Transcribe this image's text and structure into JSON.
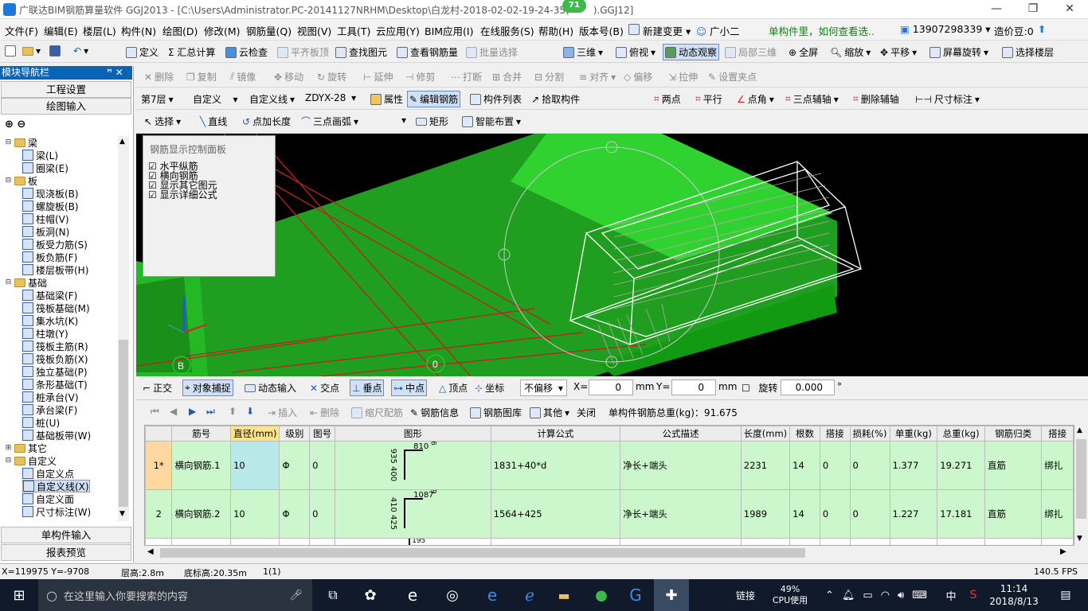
{
  "app": {
    "title": "广联达BIM钢筋算量软件 GGJ2013 - [C:\\Users\\Administrator.PC-20141127NRHM\\Desktop\\白龙村-2018-02-02-19-24-35(",
    "title_tail": ").GGJ12]",
    "badge": "71"
  },
  "menus": [
    "文件(F)",
    "编辑(E)",
    "楼层(L)",
    "构件(N)",
    "绘图(D)",
    "修改(M)",
    "钢筋量(Q)",
    "视图(V)",
    "工具(T)",
    "云应用(Y)",
    "BIM应用(I)",
    "在线服务(S)",
    "帮助(H)",
    "版本号(B)",
    "新建变更",
    "广小二",
    "单构件里，如何查看选..",
    "13907298339",
    "造价豆:0"
  ],
  "toolbar1": [
    "定义",
    "Σ 汇总计算",
    "云检查",
    "平齐板顶",
    "查找图元",
    "查看钢筋量",
    "批量选择",
    "三维",
    "俯视",
    "动态观察",
    "局部三维",
    "全屏",
    "缩放",
    "平移",
    "屏幕旋转",
    "选择楼层"
  ],
  "toolbar2": [
    "删除",
    "复制",
    "镜像",
    "移动",
    "旋转",
    "延伸",
    "修剪",
    "打断",
    "合并",
    "分割",
    "对齐",
    "偏移",
    "拉伸",
    "设置夹点"
  ],
  "toolbar3": {
    "floor": "第7层",
    "cat": "自定义",
    "sub": "自定义线",
    "code": "ZDYX-28",
    "items": [
      "属性",
      "编辑钢筋",
      "构件列表",
      "拾取构件"
    ],
    "axis": [
      "两点",
      "平行",
      "点角",
      "三点辅轴",
      "删除辅轴",
      "尺寸标注"
    ]
  },
  "toolbar4": [
    "选择",
    "直线",
    "点加长度",
    "三点画弧",
    "矩形",
    "智能布置"
  ],
  "nav": {
    "header": "模块导航栏",
    "pin": "ꟸ ✕",
    "btn1": "工程设置",
    "btn2": "绘图输入",
    "btn3": "单构件输入",
    "btn4": "报表预览"
  },
  "tree": [
    {
      "t": "梁",
      "lvl": 0,
      "f": true,
      "e": "⊟"
    },
    {
      "t": "梁(L)",
      "lvl": 1
    },
    {
      "t": "圈梁(E)",
      "lvl": 1
    },
    {
      "t": "板",
      "lvl": 0,
      "f": true,
      "e": "⊟"
    },
    {
      "t": "现浇板(B)",
      "lvl": 1
    },
    {
      "t": "螺旋板(B)",
      "lvl": 1
    },
    {
      "t": "柱帽(V)",
      "lvl": 1
    },
    {
      "t": "板洞(N)",
      "lvl": 1
    },
    {
      "t": "板受力筋(S)",
      "lvl": 1
    },
    {
      "t": "板负筋(F)",
      "lvl": 1
    },
    {
      "t": "楼层板带(H)",
      "lvl": 1
    },
    {
      "t": "基础",
      "lvl": 0,
      "f": true,
      "e": "⊟"
    },
    {
      "t": "基础梁(F)",
      "lvl": 1
    },
    {
      "t": "筏板基础(M)",
      "lvl": 1
    },
    {
      "t": "集水坑(K)",
      "lvl": 1
    },
    {
      "t": "柱墩(Y)",
      "lvl": 1
    },
    {
      "t": "筏板主筋(R)",
      "lvl": 1
    },
    {
      "t": "筏板负筋(X)",
      "lvl": 1
    },
    {
      "t": "独立基础(P)",
      "lvl": 1
    },
    {
      "t": "条形基础(T)",
      "lvl": 1
    },
    {
      "t": "桩承台(V)",
      "lvl": 1
    },
    {
      "t": "承台梁(F)",
      "lvl": 1
    },
    {
      "t": "桩(U)",
      "lvl": 1
    },
    {
      "t": "基础板带(W)",
      "lvl": 1
    },
    {
      "t": "其它",
      "lvl": 0,
      "f": true,
      "e": "⊞"
    },
    {
      "t": "自定义",
      "lvl": 0,
      "f": true,
      "e": "⊟"
    },
    {
      "t": "自定义点",
      "lvl": 1
    },
    {
      "t": "自定义线(X)",
      "lvl": 1,
      "sel": true
    },
    {
      "t": "自定义面",
      "lvl": 1
    },
    {
      "t": "尺寸标注(W)",
      "lvl": 1
    }
  ],
  "rebar_panel": {
    "title": "钢筋显示控制面板",
    "items": [
      "水平纵筋",
      "横向钢筋",
      "显示其它图元",
      "显示详细公式"
    ]
  },
  "viewport": {
    "label_b": "B",
    "label_0": "0"
  },
  "snap": {
    "items": [
      "正交",
      "对象捕捉",
      "动态输入",
      "交点",
      "垂点",
      "中点",
      "顶点",
      "坐标"
    ],
    "offset": "不偏移",
    "x_label": "X=",
    "x_val": "0",
    "y_label": "Y=",
    "y_val": "0",
    "unit": "mm",
    "rotate": "旋转",
    "rotate_val": "0.000",
    "deg": "°"
  },
  "tablebar": {
    "items": [
      "插入",
      "删除",
      "缩尺配筋",
      "钢筋信息",
      "钢筋图库",
      "其他",
      "关闭"
    ],
    "weight": "单构件钢筋总重(kg)：91.675"
  },
  "table": {
    "headers": [
      "",
      "筋号",
      "直径(mm)",
      "级别",
      "图号",
      "图形",
      "计算公式",
      "公式描述",
      "长度(mm)",
      "根数",
      "搭接",
      "损耗(%)",
      "单重(kg)",
      "总重(kg)",
      "钢筋归类",
      "搭接"
    ],
    "rows": [
      [
        "1*",
        "横向钢筋.1",
        "10",
        "Φ",
        "0",
        "",
        "1831+40*d",
        "净长+端头",
        "2231",
        "14",
        "0",
        "0",
        "1.377",
        "19.271",
        "直筋",
        "绑扎"
      ],
      [
        "2",
        "横向钢筋.2",
        "10",
        "Φ",
        "0",
        "",
        "1564+425",
        "净长+端头",
        "1989",
        "14",
        "0",
        "0",
        "1.227",
        "17.181",
        "直筋",
        "绑扎"
      ]
    ],
    "shape1": {
      "a": "935 400",
      "b": "810",
      "c": "96"
    },
    "shape2": {
      "a": "410 425",
      "b": "1087",
      "c": "99"
    },
    "shape3": "195"
  },
  "status": {
    "coord": "X=119975 Y=-9708",
    "floorh": "层高:2.8m",
    "bottom": "底标高:20.35m",
    "count": "1(1)",
    "fps": "140.5 FPS"
  },
  "taskbar": {
    "search": "在这里输入你要搜索的内容",
    "net": "链接",
    "cpu": "49%",
    "cpu_label": "CPU使用",
    "ime": "中",
    "time": "11:14",
    "date": "2018/8/13"
  }
}
